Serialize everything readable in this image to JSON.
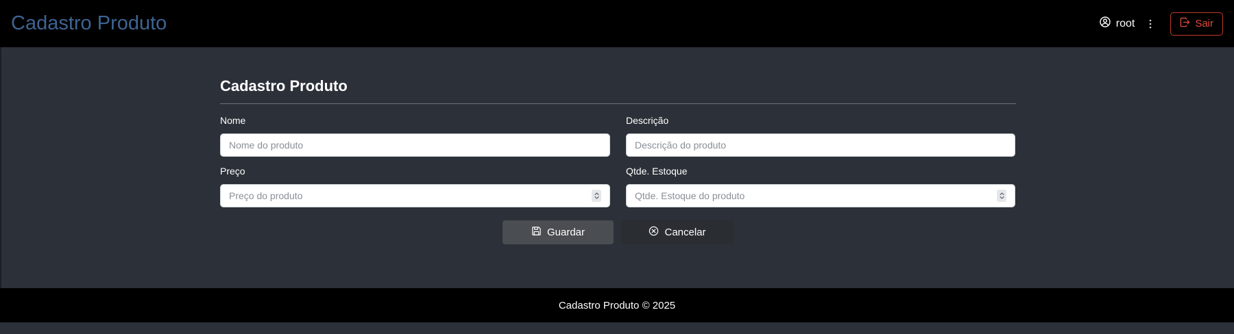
{
  "header": {
    "brand": "Cadastro Produto",
    "user_name": "root",
    "logout_label": "Sair"
  },
  "form": {
    "title": "Cadastro Produto",
    "fields": [
      {
        "label": "Nome",
        "placeholder": "Nome do produto",
        "value": ""
      },
      {
        "label": "Descrição",
        "placeholder": "Descrição do produto",
        "value": ""
      },
      {
        "label": "Preço",
        "placeholder": "Preço do produto",
        "value": ""
      },
      {
        "label": "Qtde. Estoque",
        "placeholder": "Qtde. Estoque do produto",
        "value": ""
      }
    ],
    "save_label": "Guardar",
    "cancel_label": "Cancelar"
  },
  "footer": {
    "text": "Cadastro Produto © 2025"
  },
  "icons": {
    "user": "user-circle-icon",
    "menu": "kebab-menu-icon",
    "logout": "logout-icon",
    "save": "floppy-disk-icon",
    "cancel": "x-circle-icon",
    "spinner": "spinner-icon"
  },
  "colors": {
    "brand": "#3e6492",
    "topbar_bg": "#000000",
    "page_bg": "#2c3038",
    "logout_accent": "#e04b3f",
    "save_button_bg": "#4a4d51",
    "cancel_button_bg": "#2a2d32"
  }
}
